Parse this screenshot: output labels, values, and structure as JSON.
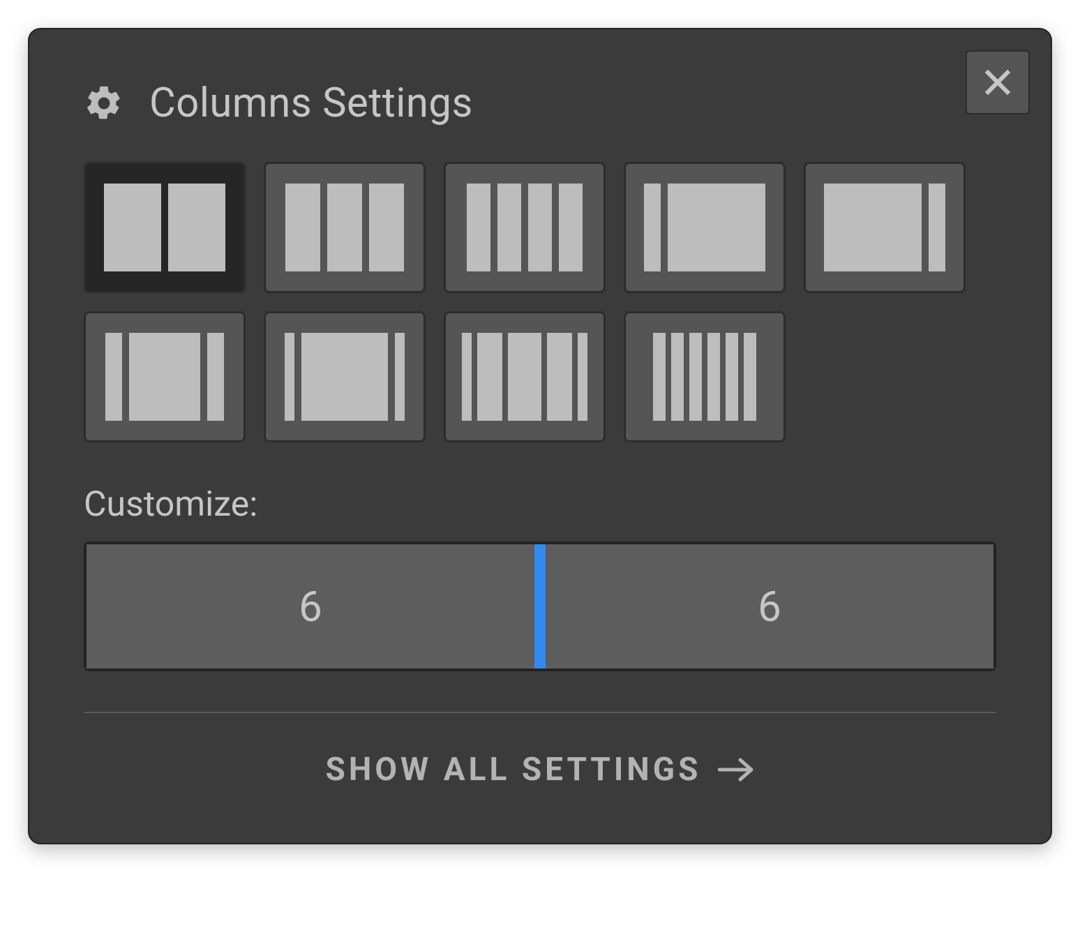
{
  "header": {
    "title": "Columns Settings"
  },
  "presets": [
    {
      "name": "preset-6-6",
      "widths": [
        82,
        82
      ],
      "selected": true
    },
    {
      "name": "preset-4-4-4",
      "widths": [
        50,
        50,
        50
      ],
      "selected": false
    },
    {
      "name": "preset-3-3-3-3",
      "widths": [
        34,
        34,
        34,
        34
      ],
      "selected": false
    },
    {
      "name": "preset-2-10",
      "widths": [
        24,
        140
      ],
      "selected": false
    },
    {
      "name": "preset-10-2",
      "widths": [
        140,
        24
      ],
      "selected": false
    },
    {
      "name": "preset-2-8-2",
      "widths": [
        24,
        102,
        24
      ],
      "selected": false
    },
    {
      "name": "preset-1-10-1",
      "widths": [
        14,
        124,
        14
      ],
      "selected": false
    },
    {
      "name": "preset-1-3-4-3-1",
      "widths": [
        14,
        36,
        48,
        36,
        14
      ],
      "selected": false
    },
    {
      "name": "preset-2-2-2-2-2-2",
      "widths": [
        18,
        18,
        18,
        18,
        18,
        18
      ],
      "selected": false
    }
  ],
  "customize": {
    "label": "Customize:",
    "columns": [
      "6",
      "6"
    ]
  },
  "footer": {
    "label": "SHOW ALL SETTINGS"
  }
}
